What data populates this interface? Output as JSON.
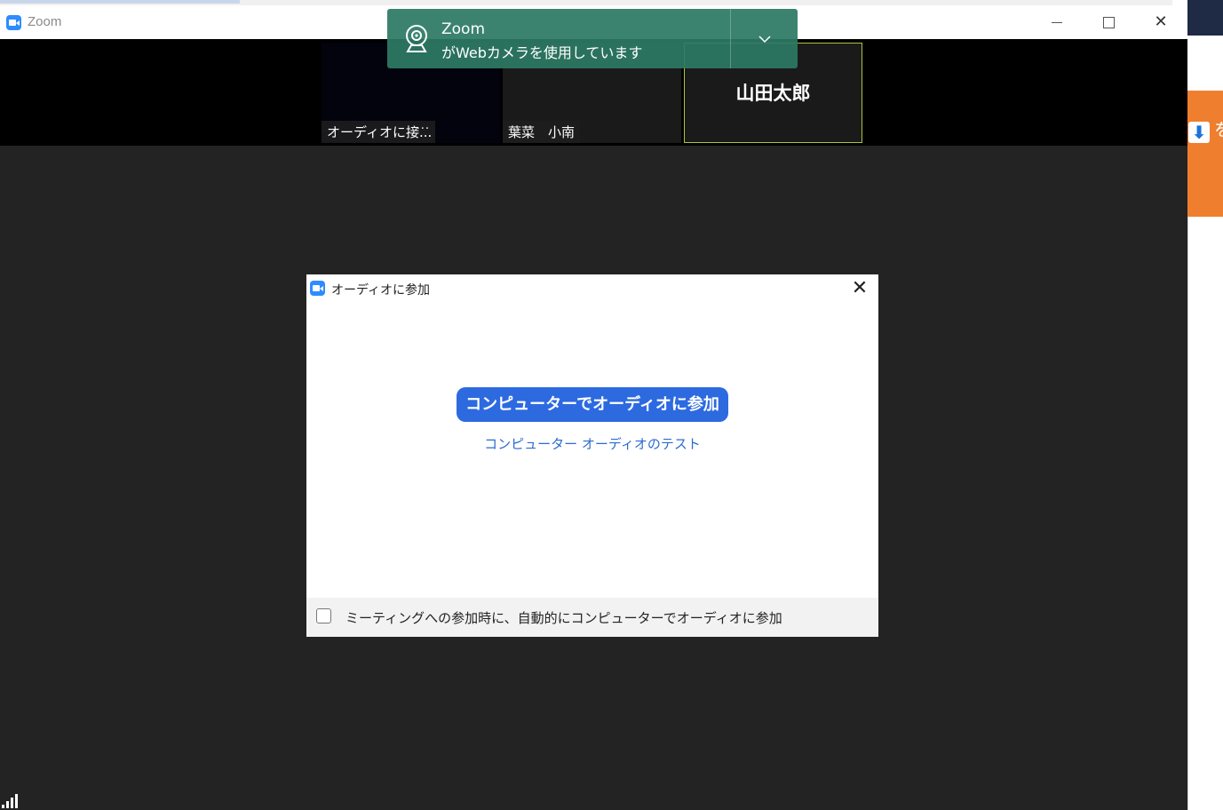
{
  "window": {
    "title": "Zoom"
  },
  "notification": {
    "title": "Zoom",
    "message": "がWebカメラを使用しています",
    "expand_icon": "chevron-down-icon"
  },
  "participants": [
    {
      "label": "オーディオに接...",
      "more": "···"
    },
    {
      "label": "葉菜　小南"
    },
    {
      "name": "山田太郎"
    }
  ],
  "dialog": {
    "title": "オーディオに参加",
    "join_button": "コンピューターでオーディオに参加",
    "test_link": "コンピューター オーディオのテスト",
    "auto_join_label": "ミーティングへの参加時に、自動的にコンピューターでオーディオに参加",
    "auto_join_checked": false
  },
  "background_app": {
    "partial_char": "を"
  },
  "colors": {
    "meeting_bg": "#232323",
    "toast_bg": "#2d7a64",
    "primary": "#2d6ae0",
    "link": "#2a6bd1",
    "active_speaker": "#a7c43a",
    "accent_orange": "#ef7f2e"
  }
}
